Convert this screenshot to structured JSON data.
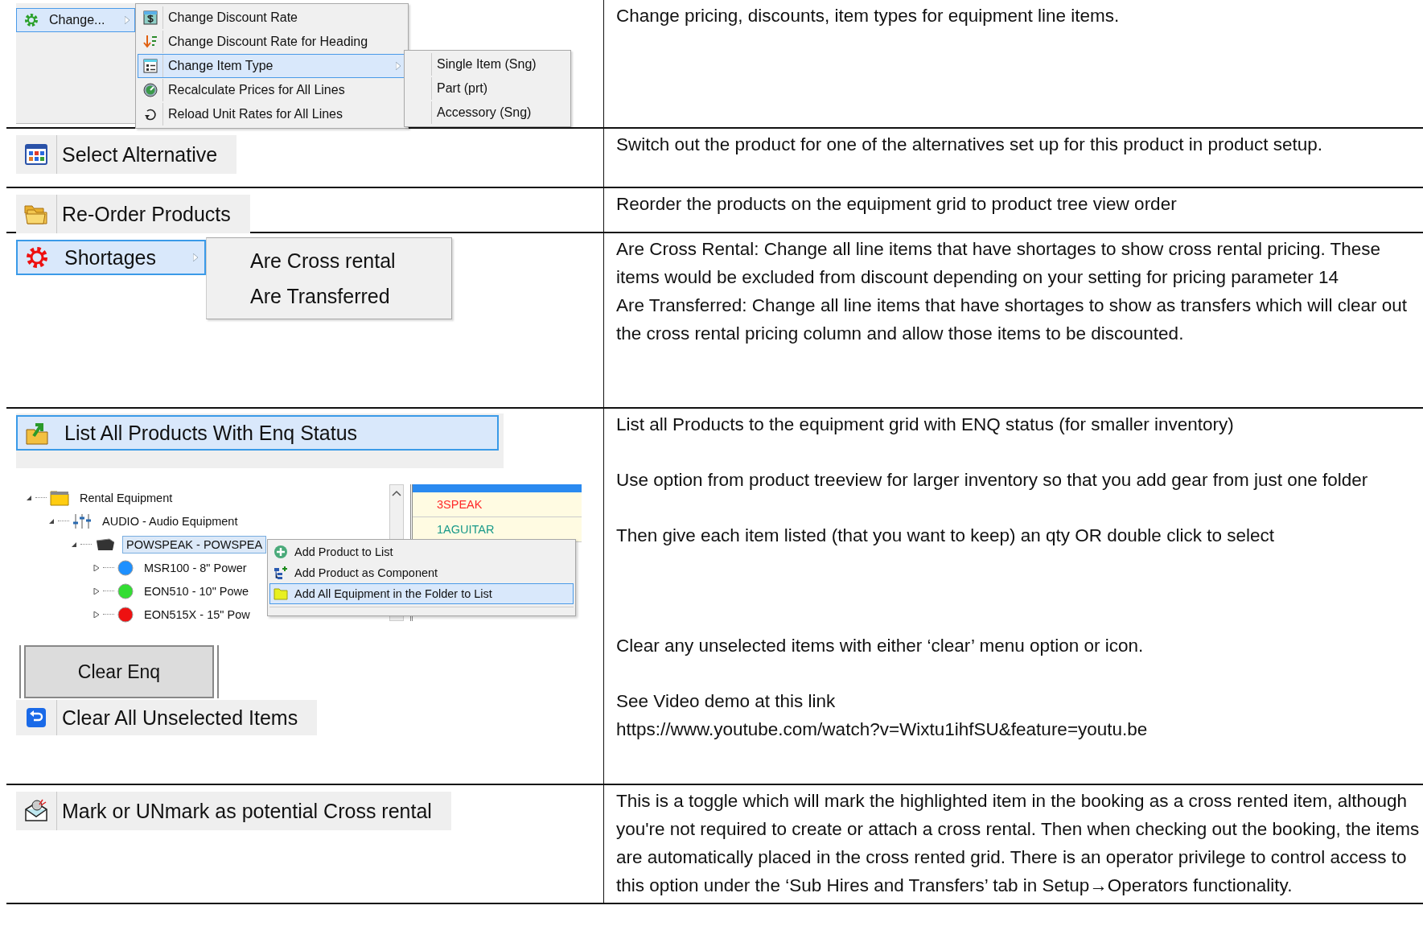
{
  "rows": [
    {
      "kind": "change_menu",
      "menu": {
        "label": "Change...",
        "selected": true,
        "items": [
          {
            "label": "Change Discount Rate",
            "selected": false,
            "has_submenu": false
          },
          {
            "label": "Change Discount Rate for Heading",
            "selected": false,
            "has_submenu": false
          },
          {
            "label": "Change Item Type",
            "selected": true,
            "has_submenu": true
          },
          {
            "label": "Recalculate Prices for All Lines",
            "selected": false,
            "has_submenu": false
          },
          {
            "label": "Reload Unit Rates for All Lines",
            "selected": false,
            "has_submenu": false
          }
        ],
        "submenu_items": [
          "Single Item (Sng)",
          "Part (prt)",
          "Accessory (Sng)"
        ]
      },
      "description": [
        "Change pricing, discounts, item types for equipment line items."
      ]
    },
    {
      "kind": "toolbar_item",
      "label": "Select Alternative",
      "description": [
        "Switch out the product for one of the alternatives set up for this product in product setup."
      ]
    },
    {
      "kind": "toolbar_item",
      "label": "Re-Order Products",
      "description": [
        "Reorder the products on the equipment grid to product tree view order"
      ]
    },
    {
      "kind": "shortages_menu",
      "menu": {
        "label": "Shortages",
        "selected": true,
        "items": [
          "Are Cross rental",
          "Are Transferred"
        ]
      },
      "description": [
        "Are Cross Rental: Change all line items that have shortages to show cross rental pricing.  These items would be excluded from discount depending on your setting for pricing parameter 14",
        "Are Transferred: Change all line items that have shortages to show as transfers which will clear out the cross rental pricing column and allow those items to be discounted."
      ]
    },
    {
      "kind": "enq_list",
      "list_button": {
        "label": "List All Products With Enq Status",
        "selected": true
      },
      "tree": [
        {
          "label": "Rental Equipment",
          "expanded": true,
          "selected": false,
          "children": [
            {
              "label": "AUDIO - Audio Equipment",
              "expanded": true,
              "selected": false,
              "children": [
                {
                  "label": "POWSPEAK - POWSPEA",
                  "expanded": true,
                  "selected": true,
                  "children": [
                    {
                      "label": "MSR100  - 8\" Power",
                      "expanded": false,
                      "selected": false,
                      "color": "#1e90ff"
                    },
                    {
                      "label": "EON510  - 10\" Powe",
                      "expanded": false,
                      "selected": false,
                      "color": "#33dd33"
                    },
                    {
                      "label": "EON515X  - 15\" Pow",
                      "expanded": false,
                      "selected": false,
                      "color": "#ee1111"
                    }
                  ]
                }
              ]
            }
          ]
        }
      ],
      "grid_rows": [
        {
          "text": "3SPEAK",
          "color": "#ff2a2a"
        },
        {
          "text": "1AGUITAR",
          "color": "#1a9a8a"
        }
      ],
      "context_menu": [
        {
          "label": "Add Product to List",
          "selected": false
        },
        {
          "label": "Add Product as Component",
          "selected": false
        },
        {
          "label": "Add All Equipment in the Folder to List",
          "selected": true
        }
      ],
      "clear_button": "Clear Enq",
      "clear_item": "Clear All Unselected Items",
      "description": [
        "List all Products to the equipment grid with ENQ status (for smaller inventory)",
        "Use option from product treeview for larger inventory so that you add gear from just one folder",
        "Then give each item listed (that you want to keep) an qty OR double click to select",
        "Clear any unselected items with either ‘clear’ menu option or icon.",
        "See Video demo at this link",
        "https://www.youtube.com/watch?v=Wixtu1ihfSU&feature=youtu.be"
      ]
    },
    {
      "kind": "toolbar_item",
      "label": "Mark or UNmark as potential Cross rental",
      "description": [
        "This is a toggle which will mark the highlighted item in the booking as a cross rented item, although you're not required to create or attach a cross rental. Then when checking out the booking, the items are automatically placed in the cross rented grid. There is an operator privilege to control access to this option under the ‘Sub Hires and Transfers’ tab in Setup→Operators functionality."
      ]
    }
  ]
}
